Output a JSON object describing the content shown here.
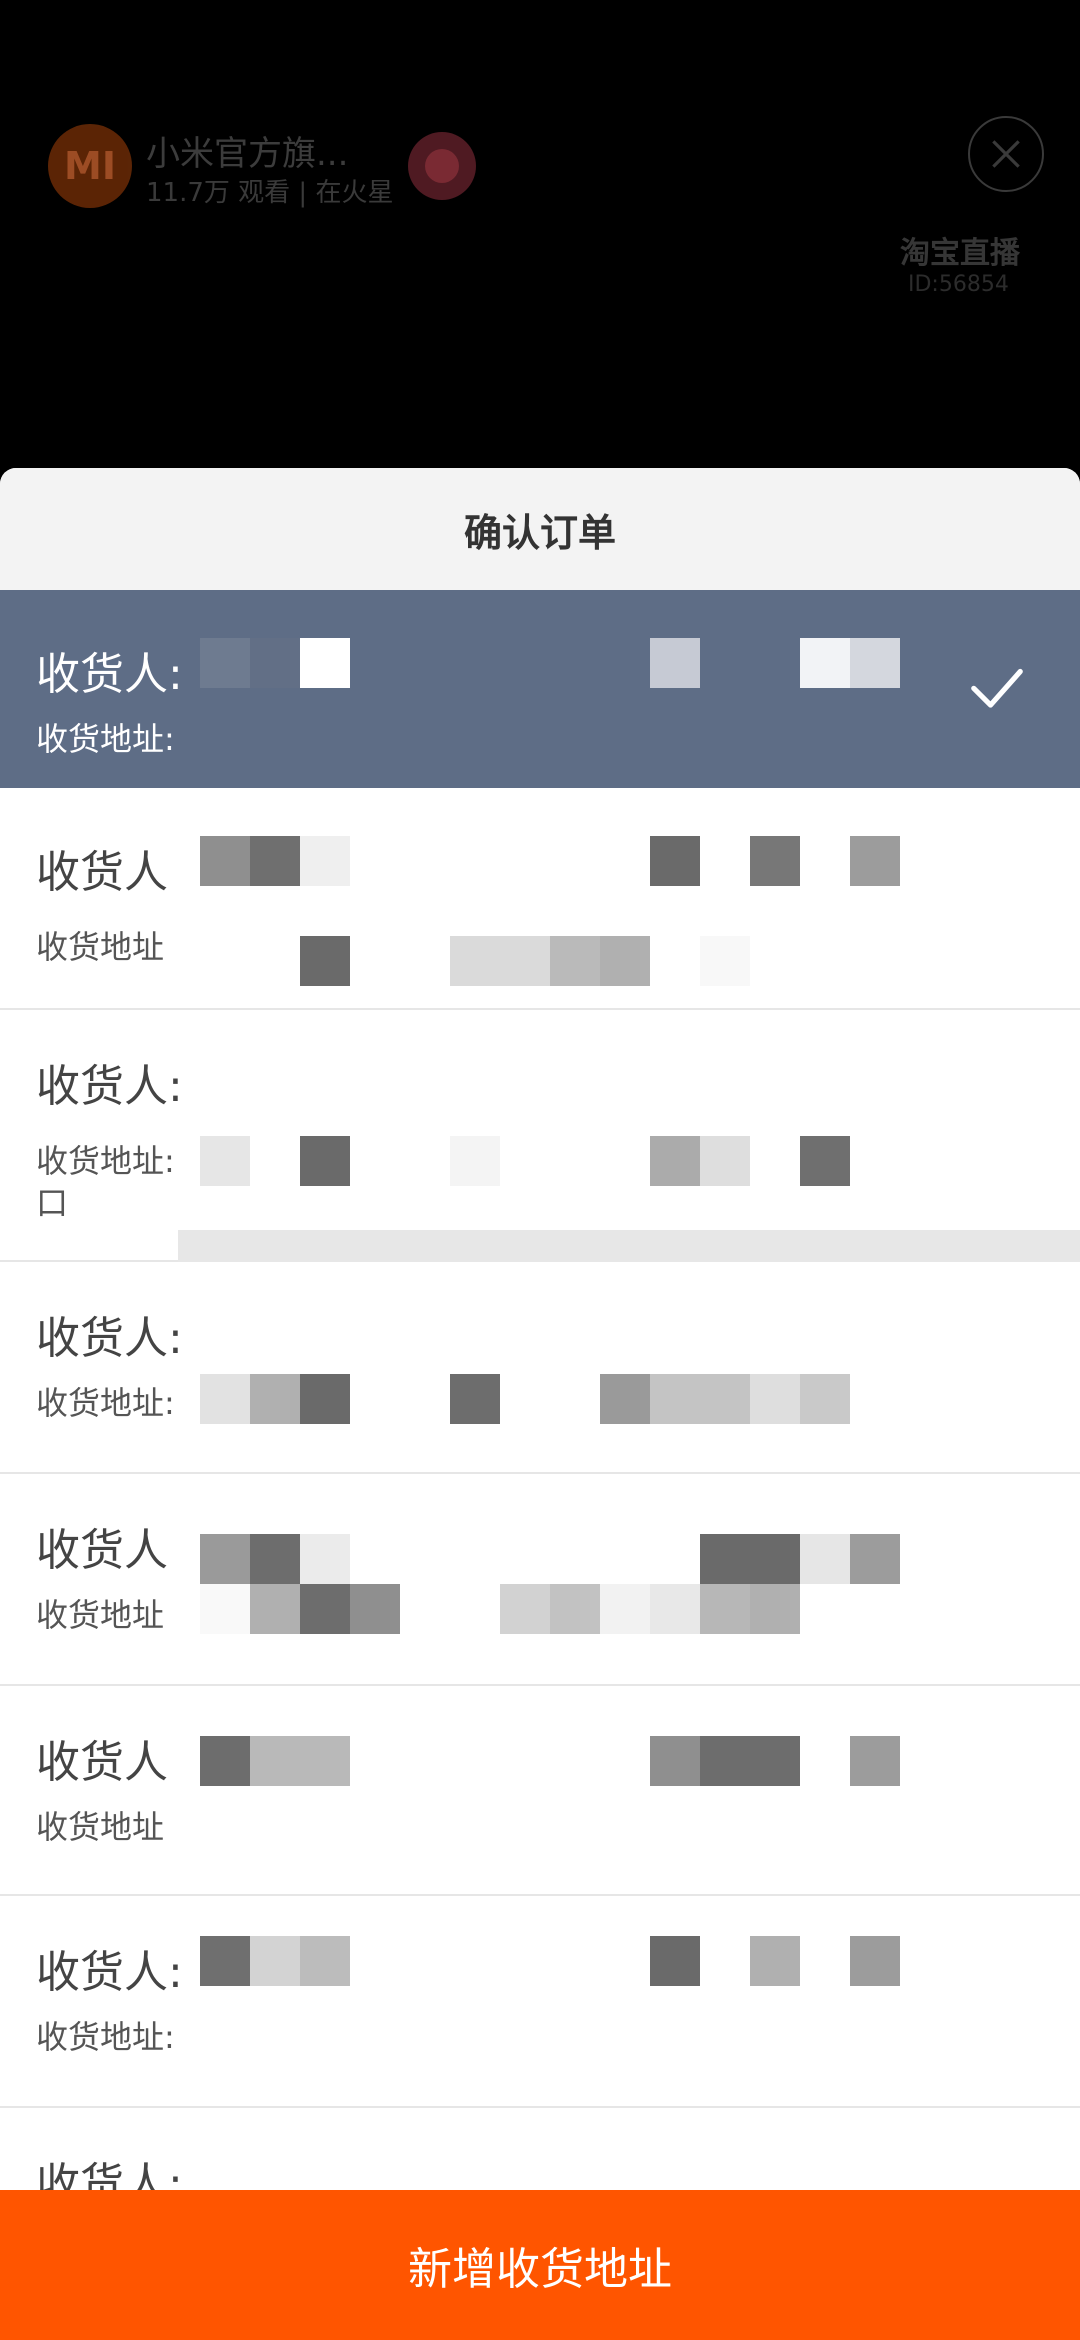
{
  "live": {
    "shop_logo_text": "MI",
    "shop_name": "小米官方旗...",
    "stats": "11.7万 观看 | 在火星",
    "watermark": "淘宝直播",
    "watermark_id": "ID:56854"
  },
  "sheet": {
    "title": "确认订单",
    "addresses": [
      {
        "name_label": "收货人:",
        "addr_label": "收货地址:",
        "selected": true
      },
      {
        "name_label": "收货人",
        "addr_label": "收货地址"
      },
      {
        "name_label": "收货人:",
        "addr_label": "收货地址:",
        "extra": "口"
      },
      {
        "name_label": "收货人:",
        "addr_label": "收货地址:"
      },
      {
        "name_label": "收货人",
        "addr_label": "收货地址"
      },
      {
        "name_label": "收货人",
        "addr_label": "收货地址"
      },
      {
        "name_label": "收货人:",
        "addr_label": "收货地址:"
      },
      {
        "name_label": "收货人:",
        "addr_label": ""
      }
    ],
    "add_button": "新增收货地址"
  }
}
